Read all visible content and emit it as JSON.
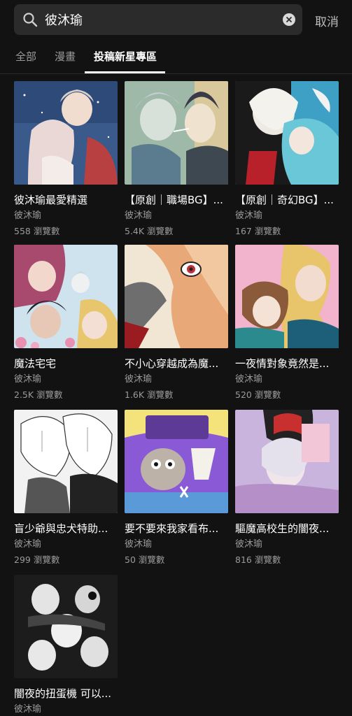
{
  "search": {
    "query": "彼沐瑜",
    "cancel_label": "取消"
  },
  "tabs": [
    {
      "label": "全部"
    },
    {
      "label": "漫畫"
    },
    {
      "label": "投稿新星專區"
    }
  ],
  "results": [
    {
      "title": "彼沐瑜最愛精選",
      "author": "彼沐瑜",
      "views": "558 瀏覽數"
    },
    {
      "title": "【原創｜職場BG】...",
      "author": "彼沐瑜",
      "views": "5.4K 瀏覽數"
    },
    {
      "title": "【原創｜奇幻BG】...",
      "author": "彼沐瑜",
      "views": "167 瀏覽數"
    },
    {
      "title": "魔法宅宅",
      "author": "彼沐瑜",
      "views": "2.5K 瀏覽數"
    },
    {
      "title": "不小心穿越成為魔...",
      "author": "彼沐瑜",
      "views": "1.6K 瀏覽數"
    },
    {
      "title": "一夜情對象竟然是...",
      "author": "彼沐瑜",
      "views": "520 瀏覽數"
    },
    {
      "title": "盲少爺與忠犬特助...",
      "author": "彼沐瑜",
      "views": "299 瀏覽數"
    },
    {
      "title": "要不要來我家看布...",
      "author": "彼沐瑜",
      "views": "50 瀏覽數"
    },
    {
      "title": "驅魔高校生的闇夜...",
      "author": "彼沐瑜",
      "views": "816 瀏覽數"
    },
    {
      "title": "闇夜的扭蛋機 可以...",
      "author": "彼沐瑜",
      "views": ""
    }
  ],
  "colors": {
    "background": "#121212",
    "search_box": "#2b2b2b",
    "muted_text": "#9a9a9a"
  }
}
